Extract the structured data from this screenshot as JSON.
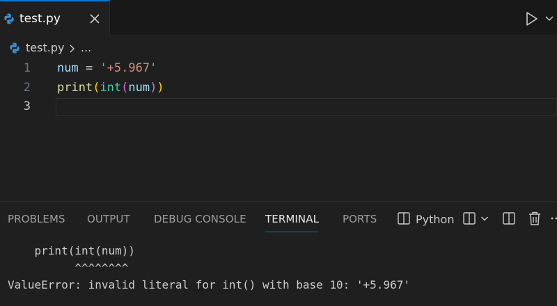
{
  "tab": {
    "filename": "test.py",
    "icon": "python-icon",
    "close_icon": "close-icon"
  },
  "toolbar": {
    "run_icon": "play-icon",
    "run_menu_icon": "chevron-down-icon"
  },
  "breadcrumb": {
    "file": "test.py",
    "separator_icon": "chevron-right-icon",
    "ellipsis": "..."
  },
  "editor": {
    "lines": [
      {
        "number": "1",
        "code": "num = '+5.967'"
      },
      {
        "number": "2",
        "code": "print(int(num))"
      },
      {
        "number": "3",
        "code": ""
      }
    ],
    "active_line": 3,
    "tokens": {
      "l1_var": "num",
      "l1_eq": " = ",
      "l1_str": "'+5.967'",
      "l2_print": "print",
      "l2_p1": "(",
      "l2_int": "int",
      "l2_p2": "(",
      "l2_arg": "num",
      "l2_p3": ")",
      "l2_p4": ")"
    }
  },
  "panel": {
    "tabs": [
      "PROBLEMS",
      "OUTPUT",
      "DEBUG CONSOLE",
      "TERMINAL",
      "PORTS"
    ],
    "active_tab": "TERMINAL",
    "terminal_name": "Python",
    "icons": [
      "terminal-icon",
      "split-terminal-icon",
      "chevron-down-icon",
      "layout-icon",
      "trash-icon",
      "more-icon"
    ]
  },
  "terminal": {
    "lines": [
      "    print(int(num))",
      "          ^^^^^^^^",
      "ValueError: invalid literal for int() with base 10: '+5.967'"
    ]
  },
  "colors": {
    "accent": "#0078d4",
    "background": "#1f1f1f",
    "tabbar": "#181818"
  }
}
